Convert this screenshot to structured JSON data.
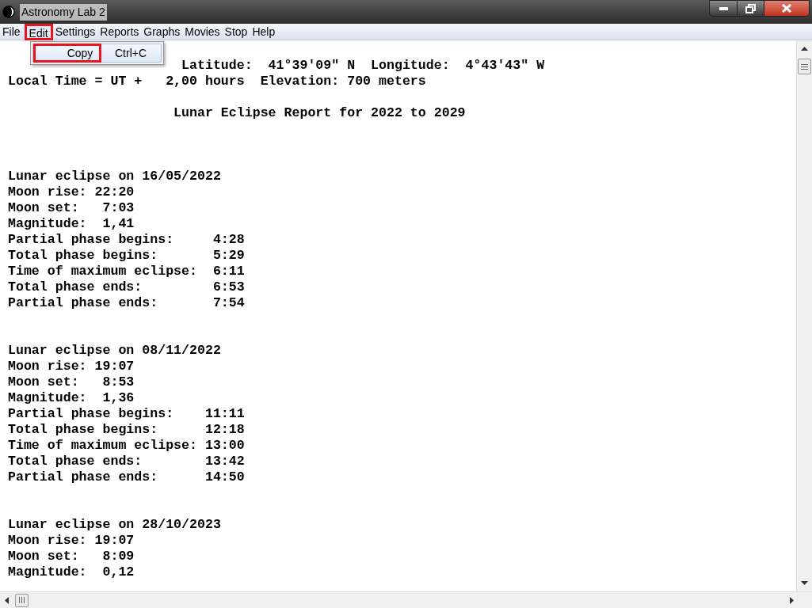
{
  "window": {
    "title": "Astronomy Lab 2"
  },
  "menu": [
    {
      "label": "File",
      "selected": false,
      "highlighted": false
    },
    {
      "label": "Edit",
      "selected": true,
      "highlighted": true
    },
    {
      "label": "Settings",
      "selected": false,
      "highlighted": false
    },
    {
      "label": "Reports",
      "selected": false,
      "highlighted": false
    },
    {
      "label": "Graphs",
      "selected": false,
      "highlighted": false
    },
    {
      "label": "Movies",
      "selected": false,
      "highlighted": false
    },
    {
      "label": "Stop",
      "selected": false,
      "highlighted": false
    },
    {
      "label": "Help",
      "selected": false,
      "highlighted": false
    }
  ],
  "dropdown": {
    "items": [
      {
        "label": "Copy",
        "shortcut": "Ctrl+C",
        "highlighted": true
      }
    ]
  },
  "report": {
    "header": [
      "Latitude:  41°39'09\" N  Longitude:  4°43'43\" W",
      "Local Time = UT +   2,00 hours  Elevation: 700 meters"
    ],
    "title": "Lunar Eclipse Report for 2022 to 2029",
    "eclipses": [
      {
        "heading": "Lunar eclipse on 16/05/2022",
        "lines": [
          "Moon rise: 22:20",
          "Moon set:   7:03",
          "Magnitude:  1,41",
          "Partial phase begins:     4:28",
          "Total phase begins:       5:29",
          "Time of maximum eclipse:  6:11",
          "Total phase ends:         6:53",
          "Partial phase ends:       7:54"
        ]
      },
      {
        "heading": "Lunar eclipse on 08/11/2022",
        "lines": [
          "Moon rise: 19:07",
          "Moon set:   8:53",
          "Magnitude:  1,36",
          "Partial phase begins:    11:11",
          "Total phase begins:      12:18",
          "Time of maximum eclipse: 13:00",
          "Total phase ends:        13:42",
          "Partial phase ends:      14:50"
        ]
      },
      {
        "heading": "Lunar eclipse on 28/10/2023",
        "lines": [
          "Moon rise: 19:07",
          "Moon set:   8:09",
          "Magnitude:  0,12"
        ]
      }
    ]
  }
}
